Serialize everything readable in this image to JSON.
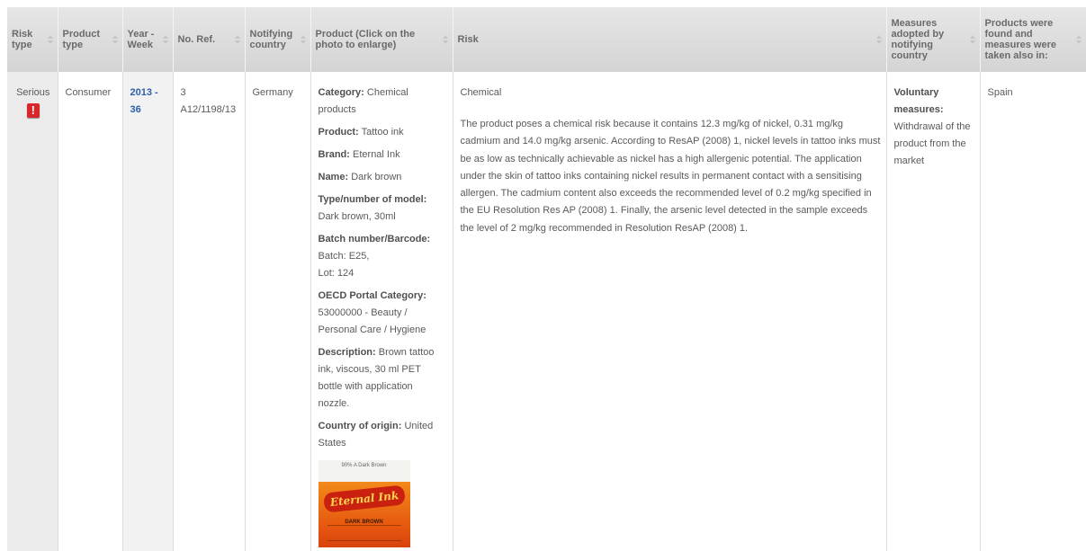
{
  "headers": {
    "risk_type": "Risk type",
    "product_type": "Product type",
    "year_week": "Year - Week",
    "no_ref": "No. Ref.",
    "notifying_country": "Notifying country",
    "product": "Product (Click on the photo to enlarge)",
    "risk": "Risk",
    "measures": "Measures adopted by notifying country",
    "found_also": "Products were found and measures were taken also in:"
  },
  "row": {
    "risk_type": "Serious",
    "risk_icon": "warning-icon",
    "product_type": "Consumer",
    "year_week": "2013 - 36",
    "no": "3",
    "ref": "A12/1198/13",
    "notifying_country": "Germany",
    "product_info": [
      {
        "label": "Category:",
        "value": "Chemical products"
      },
      {
        "label": "Product:",
        "value": "Tattoo ink"
      },
      {
        "label": "Brand:",
        "value": "Eternal Ink"
      },
      {
        "label": "Name:",
        "value": "Dark brown"
      },
      {
        "label": "Type/number of model:",
        "value": "Dark brown, 30ml"
      },
      {
        "label": "Batch number/Barcode:",
        "value": "Batch: E25,",
        "value2": "Lot: 124"
      },
      {
        "label": "OECD Portal Category:",
        "value": "53000000 - Beauty / Personal Care / Hygiene"
      },
      {
        "label": "Description:",
        "value": "Brown tattoo ink, viscous, 30 ml PET bottle with application nozzle."
      },
      {
        "label": "Country of origin:",
        "value": "United States"
      }
    ],
    "photo": {
      "top_label": "90% A Dark Brown",
      "brand": "Eternal Ink",
      "caption": "DARK BROWN"
    },
    "risk_category": "Chemical",
    "risk_text": "The product poses a chemical risk because it contains 12.3 mg/kg of nickel, 0.31 mg/kg cadmium and 14.0 mg/kg arsenic. According to ResAP (2008) 1, nickel levels in tattoo inks must be as low as technically achievable as nickel has a high allergenic potential. The application under the skin of tattoo inks containing nickel results in permanent contact with a sensitising allergen. The cadmium content also exceeds the recommended level of 0.2 mg/kg specified in the EU Resolution Res AP (2008) 1. Finally, the arsenic level detected in the sample exceeds the level of 2 mg/kg recommended in Resolution ResAP (2008) 1.",
    "measures_label": "Voluntary measures:",
    "measures_text": "Withdrawal of the product from the market",
    "found_also": "Spain"
  },
  "colors": {
    "header_bg": "#d9d9d9",
    "link": "#2b5ea8",
    "warning": "#d8262b"
  }
}
